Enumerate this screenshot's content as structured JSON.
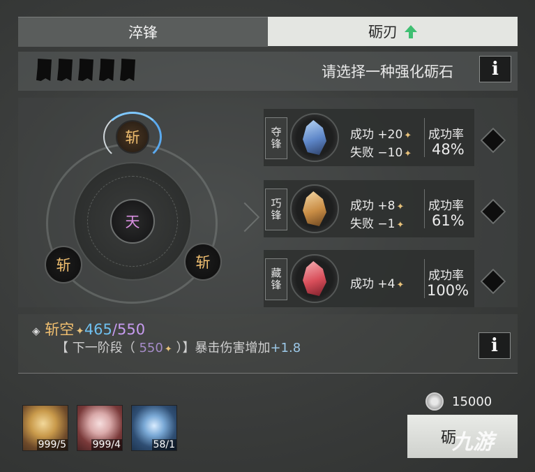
{
  "tabs": [
    {
      "label": "淬锋",
      "active": false
    },
    {
      "label": "砺刃",
      "active": true,
      "badge_icon": "green-up-arrow-icon"
    }
  ],
  "header": {
    "prompt": "请选择一种强化砺石",
    "info_label": "i",
    "flag_count": 5
  },
  "wheel": {
    "center": "天",
    "top": "斩",
    "left": "斩",
    "right": "斩"
  },
  "stones": [
    {
      "name": "夺锋",
      "success": "成功 +20",
      "fail": "失败 −10",
      "rate_label": "成功率",
      "rate": "48%",
      "color": "blue"
    },
    {
      "name": "巧锋",
      "success": "成功 +8",
      "fail": "失败 −1",
      "rate_label": "成功率",
      "rate": "61%",
      "color": "gold"
    },
    {
      "name": "藏锋",
      "success": "成功 +4",
      "fail": "",
      "rate_label": "成功率",
      "rate": "100%",
      "color": "red"
    }
  ],
  "skill": {
    "name": "斩空",
    "current": "465",
    "slash": "/",
    "max": "550",
    "detail_prefix": "【 下一阶段（ ",
    "detail_value": "550",
    "detail_suffix": " ）】暴击伤害增加",
    "detail_bonus": "+1.8",
    "info_label": "i"
  },
  "items": [
    {
      "count": "999/5",
      "icon": "gold-orb-icon"
    },
    {
      "count": "999/4",
      "icon": "pink-stone-icon"
    },
    {
      "count": "58/1",
      "icon": "blue-spirit-icon"
    }
  ],
  "currency": {
    "value": "15000",
    "icon": "silver-coin-icon"
  },
  "forge_button": "砺",
  "watermark": "九游",
  "colors": {
    "accent_blue": "#6fc0f0",
    "accent_purple": "#c79bf0",
    "gold_text": "#f2c070"
  }
}
